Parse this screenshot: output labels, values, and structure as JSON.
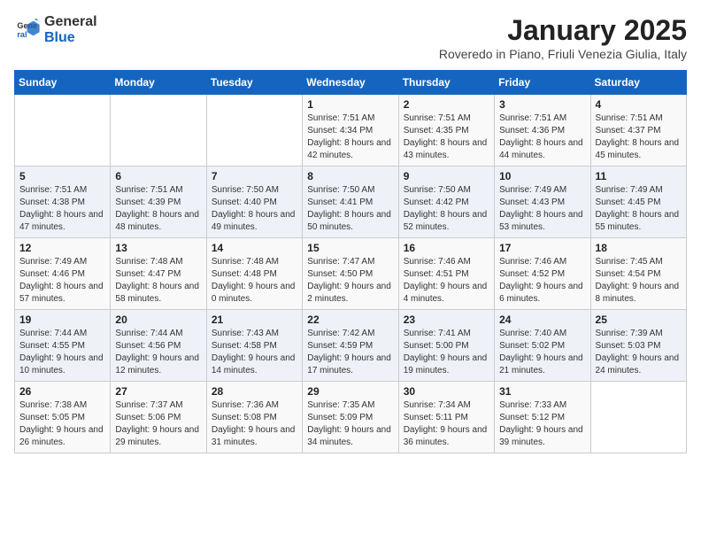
{
  "logo": {
    "general": "General",
    "blue": "Blue"
  },
  "title": "January 2025",
  "subtitle": "Roveredo in Piano, Friuli Venezia Giulia, Italy",
  "days_of_week": [
    "Sunday",
    "Monday",
    "Tuesday",
    "Wednesday",
    "Thursday",
    "Friday",
    "Saturday"
  ],
  "weeks": [
    [
      {
        "day": "",
        "sunrise": "",
        "sunset": "",
        "daylight": ""
      },
      {
        "day": "",
        "sunrise": "",
        "sunset": "",
        "daylight": ""
      },
      {
        "day": "",
        "sunrise": "",
        "sunset": "",
        "daylight": ""
      },
      {
        "day": "1",
        "sunrise": "Sunrise: 7:51 AM",
        "sunset": "Sunset: 4:34 PM",
        "daylight": "Daylight: 8 hours and 42 minutes."
      },
      {
        "day": "2",
        "sunrise": "Sunrise: 7:51 AM",
        "sunset": "Sunset: 4:35 PM",
        "daylight": "Daylight: 8 hours and 43 minutes."
      },
      {
        "day": "3",
        "sunrise": "Sunrise: 7:51 AM",
        "sunset": "Sunset: 4:36 PM",
        "daylight": "Daylight: 8 hours and 44 minutes."
      },
      {
        "day": "4",
        "sunrise": "Sunrise: 7:51 AM",
        "sunset": "Sunset: 4:37 PM",
        "daylight": "Daylight: 8 hours and 45 minutes."
      }
    ],
    [
      {
        "day": "5",
        "sunrise": "Sunrise: 7:51 AM",
        "sunset": "Sunset: 4:38 PM",
        "daylight": "Daylight: 8 hours and 47 minutes."
      },
      {
        "day": "6",
        "sunrise": "Sunrise: 7:51 AM",
        "sunset": "Sunset: 4:39 PM",
        "daylight": "Daylight: 8 hours and 48 minutes."
      },
      {
        "day": "7",
        "sunrise": "Sunrise: 7:50 AM",
        "sunset": "Sunset: 4:40 PM",
        "daylight": "Daylight: 8 hours and 49 minutes."
      },
      {
        "day": "8",
        "sunrise": "Sunrise: 7:50 AM",
        "sunset": "Sunset: 4:41 PM",
        "daylight": "Daylight: 8 hours and 50 minutes."
      },
      {
        "day": "9",
        "sunrise": "Sunrise: 7:50 AM",
        "sunset": "Sunset: 4:42 PM",
        "daylight": "Daylight: 8 hours and 52 minutes."
      },
      {
        "day": "10",
        "sunrise": "Sunrise: 7:49 AM",
        "sunset": "Sunset: 4:43 PM",
        "daylight": "Daylight: 8 hours and 53 minutes."
      },
      {
        "day": "11",
        "sunrise": "Sunrise: 7:49 AM",
        "sunset": "Sunset: 4:45 PM",
        "daylight": "Daylight: 8 hours and 55 minutes."
      }
    ],
    [
      {
        "day": "12",
        "sunrise": "Sunrise: 7:49 AM",
        "sunset": "Sunset: 4:46 PM",
        "daylight": "Daylight: 8 hours and 57 minutes."
      },
      {
        "day": "13",
        "sunrise": "Sunrise: 7:48 AM",
        "sunset": "Sunset: 4:47 PM",
        "daylight": "Daylight: 8 hours and 58 minutes."
      },
      {
        "day": "14",
        "sunrise": "Sunrise: 7:48 AM",
        "sunset": "Sunset: 4:48 PM",
        "daylight": "Daylight: 9 hours and 0 minutes."
      },
      {
        "day": "15",
        "sunrise": "Sunrise: 7:47 AM",
        "sunset": "Sunset: 4:50 PM",
        "daylight": "Daylight: 9 hours and 2 minutes."
      },
      {
        "day": "16",
        "sunrise": "Sunrise: 7:46 AM",
        "sunset": "Sunset: 4:51 PM",
        "daylight": "Daylight: 9 hours and 4 minutes."
      },
      {
        "day": "17",
        "sunrise": "Sunrise: 7:46 AM",
        "sunset": "Sunset: 4:52 PM",
        "daylight": "Daylight: 9 hours and 6 minutes."
      },
      {
        "day": "18",
        "sunrise": "Sunrise: 7:45 AM",
        "sunset": "Sunset: 4:54 PM",
        "daylight": "Daylight: 9 hours and 8 minutes."
      }
    ],
    [
      {
        "day": "19",
        "sunrise": "Sunrise: 7:44 AM",
        "sunset": "Sunset: 4:55 PM",
        "daylight": "Daylight: 9 hours and 10 minutes."
      },
      {
        "day": "20",
        "sunrise": "Sunrise: 7:44 AM",
        "sunset": "Sunset: 4:56 PM",
        "daylight": "Daylight: 9 hours and 12 minutes."
      },
      {
        "day": "21",
        "sunrise": "Sunrise: 7:43 AM",
        "sunset": "Sunset: 4:58 PM",
        "daylight": "Daylight: 9 hours and 14 minutes."
      },
      {
        "day": "22",
        "sunrise": "Sunrise: 7:42 AM",
        "sunset": "Sunset: 4:59 PM",
        "daylight": "Daylight: 9 hours and 17 minutes."
      },
      {
        "day": "23",
        "sunrise": "Sunrise: 7:41 AM",
        "sunset": "Sunset: 5:00 PM",
        "daylight": "Daylight: 9 hours and 19 minutes."
      },
      {
        "day": "24",
        "sunrise": "Sunrise: 7:40 AM",
        "sunset": "Sunset: 5:02 PM",
        "daylight": "Daylight: 9 hours and 21 minutes."
      },
      {
        "day": "25",
        "sunrise": "Sunrise: 7:39 AM",
        "sunset": "Sunset: 5:03 PM",
        "daylight": "Daylight: 9 hours and 24 minutes."
      }
    ],
    [
      {
        "day": "26",
        "sunrise": "Sunrise: 7:38 AM",
        "sunset": "Sunset: 5:05 PM",
        "daylight": "Daylight: 9 hours and 26 minutes."
      },
      {
        "day": "27",
        "sunrise": "Sunrise: 7:37 AM",
        "sunset": "Sunset: 5:06 PM",
        "daylight": "Daylight: 9 hours and 29 minutes."
      },
      {
        "day": "28",
        "sunrise": "Sunrise: 7:36 AM",
        "sunset": "Sunset: 5:08 PM",
        "daylight": "Daylight: 9 hours and 31 minutes."
      },
      {
        "day": "29",
        "sunrise": "Sunrise: 7:35 AM",
        "sunset": "Sunset: 5:09 PM",
        "daylight": "Daylight: 9 hours and 34 minutes."
      },
      {
        "day": "30",
        "sunrise": "Sunrise: 7:34 AM",
        "sunset": "Sunset: 5:11 PM",
        "daylight": "Daylight: 9 hours and 36 minutes."
      },
      {
        "day": "31",
        "sunrise": "Sunrise: 7:33 AM",
        "sunset": "Sunset: 5:12 PM",
        "daylight": "Daylight: 9 hours and 39 minutes."
      },
      {
        "day": "",
        "sunrise": "",
        "sunset": "",
        "daylight": ""
      }
    ]
  ]
}
